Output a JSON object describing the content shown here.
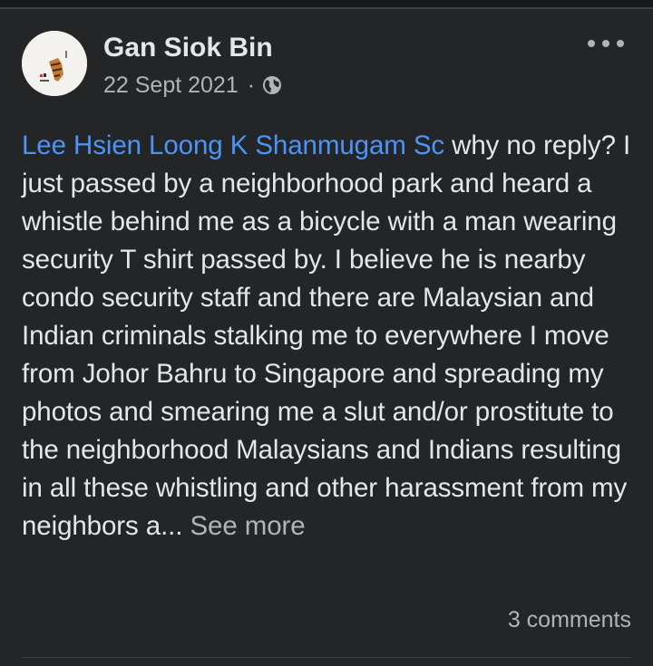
{
  "post": {
    "author": "Gan Siok Bin",
    "date": "22 Sept 2021",
    "separator": "·",
    "privacy_icon": "globe-icon",
    "more_icon": "more-horizontal-icon",
    "mentions": [
      "Lee Hsien Loong",
      "K Shanmugam Sc"
    ],
    "body_text": "why no reply? I just passed by a neighborhood park and heard a whistle behind me as a bicycle with a man wearing security T shirt passed by. I believe he is nearby condo security staff and there are Malaysian and Indian criminals stalking me to everywhere I move from Johor Bahru to Singapore and spreading my photos and smearing me a slut and/or prostitute to the neighborhood Malaysians and Indians resulting in all these whistling and other harassment from my neighbors a...",
    "see_more_label": "See more",
    "comments_label": "3 comments"
  },
  "colors": {
    "background": "#242526",
    "text_primary": "#e4e6eb",
    "text_secondary": "#b0b3b8",
    "mention": "#4c94f5",
    "divider": "#3e4042"
  }
}
